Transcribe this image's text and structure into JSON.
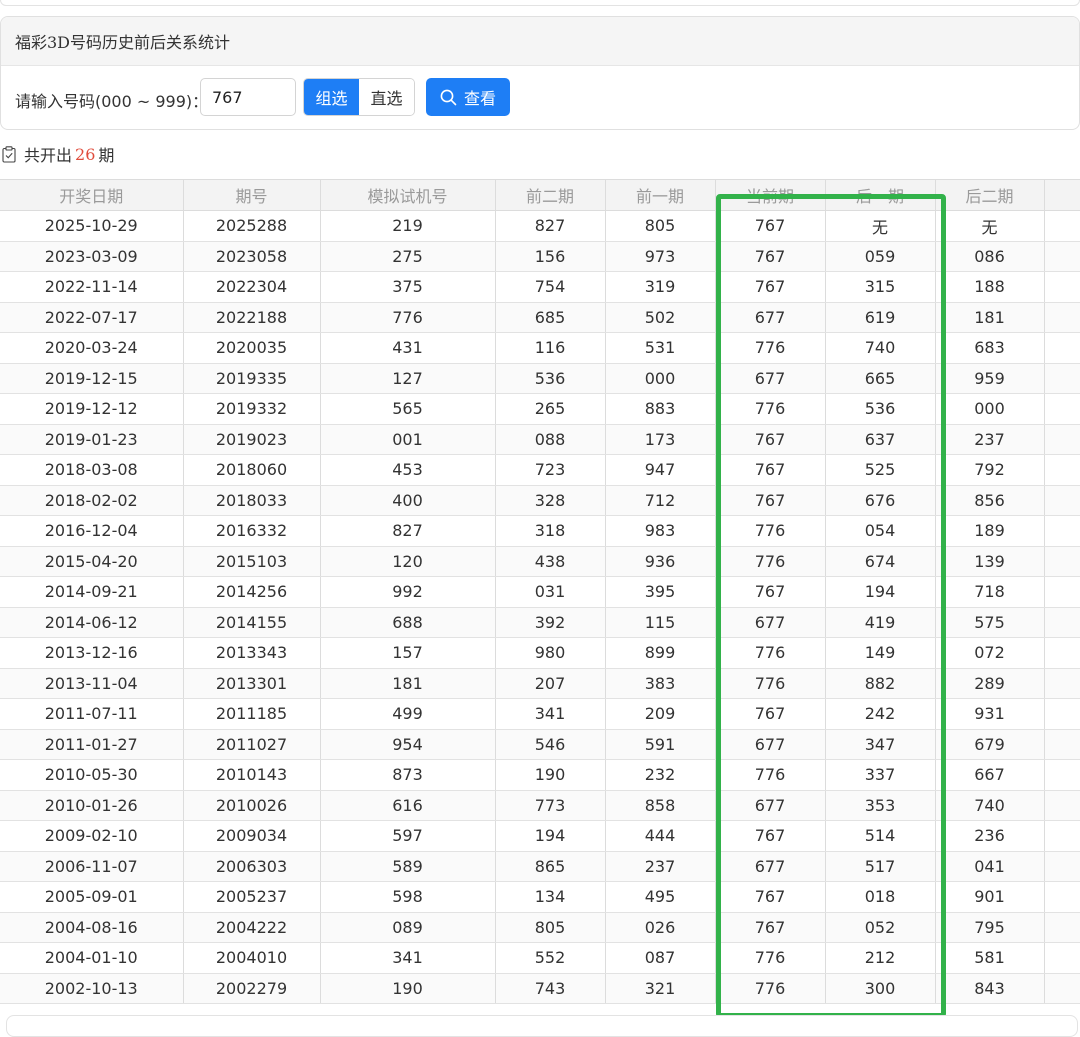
{
  "panel": {
    "title": "福彩3D号码历史前后关系统计",
    "input_label": "请输入号码(000 ~ 999)：",
    "input_value": "767",
    "mode_group_label": "组选",
    "mode_direct_label": "直选",
    "search_label": "查看"
  },
  "summary": {
    "prefix": "共开出",
    "count": "26",
    "suffix": "期"
  },
  "table": {
    "headers": [
      "开奖日期",
      "期号",
      "模拟试机号",
      "前二期",
      "前一期",
      "当前期",
      "后一期",
      "后二期"
    ],
    "rows": [
      [
        "2025-10-29",
        "2025288",
        "219",
        "827",
        "805",
        "767",
        "无",
        "无"
      ],
      [
        "2023-03-09",
        "2023058",
        "275",
        "156",
        "973",
        "767",
        "059",
        "086"
      ],
      [
        "2022-11-14",
        "2022304",
        "375",
        "754",
        "319",
        "767",
        "315",
        "188"
      ],
      [
        "2022-07-17",
        "2022188",
        "776",
        "685",
        "502",
        "677",
        "619",
        "181"
      ],
      [
        "2020-03-24",
        "2020035",
        "431",
        "116",
        "531",
        "776",
        "740",
        "683"
      ],
      [
        "2019-12-15",
        "2019335",
        "127",
        "536",
        "000",
        "677",
        "665",
        "959"
      ],
      [
        "2019-12-12",
        "2019332",
        "565",
        "265",
        "883",
        "776",
        "536",
        "000"
      ],
      [
        "2019-01-23",
        "2019023",
        "001",
        "088",
        "173",
        "767",
        "637",
        "237"
      ],
      [
        "2018-03-08",
        "2018060",
        "453",
        "723",
        "947",
        "767",
        "525",
        "792"
      ],
      [
        "2018-02-02",
        "2018033",
        "400",
        "328",
        "712",
        "767",
        "676",
        "856"
      ],
      [
        "2016-12-04",
        "2016332",
        "827",
        "318",
        "983",
        "776",
        "054",
        "189"
      ],
      [
        "2015-04-20",
        "2015103",
        "120",
        "438",
        "936",
        "776",
        "674",
        "139"
      ],
      [
        "2014-09-21",
        "2014256",
        "992",
        "031",
        "395",
        "767",
        "194",
        "718"
      ],
      [
        "2014-06-12",
        "2014155",
        "688",
        "392",
        "115",
        "677",
        "419",
        "575"
      ],
      [
        "2013-12-16",
        "2013343",
        "157",
        "980",
        "899",
        "776",
        "149",
        "072"
      ],
      [
        "2013-11-04",
        "2013301",
        "181",
        "207",
        "383",
        "776",
        "882",
        "289"
      ],
      [
        "2011-07-11",
        "2011185",
        "499",
        "341",
        "209",
        "767",
        "242",
        "931"
      ],
      [
        "2011-01-27",
        "2011027",
        "954",
        "546",
        "591",
        "677",
        "347",
        "679"
      ],
      [
        "2010-05-30",
        "2010143",
        "873",
        "190",
        "232",
        "776",
        "337",
        "667"
      ],
      [
        "2010-01-26",
        "2010026",
        "616",
        "773",
        "858",
        "677",
        "353",
        "740"
      ],
      [
        "2009-02-10",
        "2009034",
        "597",
        "194",
        "444",
        "767",
        "514",
        "236"
      ],
      [
        "2006-11-07",
        "2006303",
        "589",
        "865",
        "237",
        "677",
        "517",
        "041"
      ],
      [
        "2005-09-01",
        "2005237",
        "598",
        "134",
        "495",
        "767",
        "018",
        "901"
      ],
      [
        "2004-08-16",
        "2004222",
        "089",
        "805",
        "026",
        "767",
        "052",
        "795"
      ],
      [
        "2004-01-10",
        "2004010",
        "341",
        "552",
        "087",
        "776",
        "212",
        "581"
      ],
      [
        "2002-10-13",
        "2002279",
        "190",
        "743",
        "321",
        "776",
        "300",
        "843"
      ]
    ]
  },
  "colors": {
    "accent_blue": "#1e7ef5",
    "count_red": "#e04c3c",
    "highlight_green": "#32b24a"
  }
}
